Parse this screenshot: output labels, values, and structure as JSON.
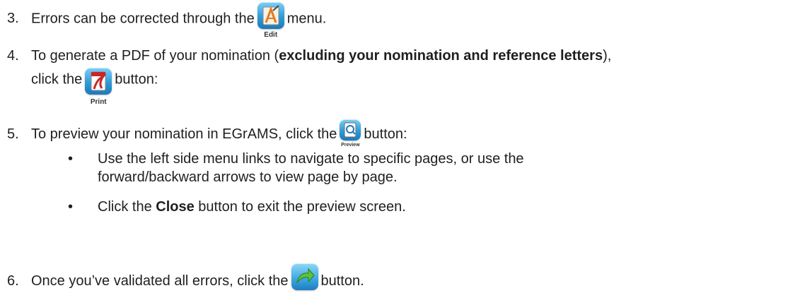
{
  "steps": [
    {
      "number": "3.",
      "before": "Errors can be corrected through the",
      "after": "menu.",
      "icon": {
        "name": "edit-icon",
        "caption": "Edit"
      }
    },
    {
      "number": "4.",
      "line1_before": "To generate a PDF of your nomination (",
      "line1_bold": "excluding your nomination and reference letters",
      "line1_after": "),",
      "line2_before": "click the",
      "line2_after": "button:",
      "icon": {
        "name": "print-icon",
        "caption": "Print"
      }
    },
    {
      "number": "5.",
      "before": "To preview your nomination in EGrAMS, click the",
      "after": "button:",
      "icon": {
        "name": "preview-icon",
        "caption": "Preview"
      },
      "bullets": [
        {
          "line1": "Use the left side menu links to navigate to specific pages, or use the",
          "line2": "forward/backward arrows to view page by page."
        },
        {
          "before": "Click the",
          "bold": "Close",
          "after": "button to exit the preview screen."
        }
      ]
    },
    {
      "number": "6.",
      "before": "Once you’ve validated all errors, click the",
      "after": "button.",
      "icon": {
        "name": "submit-arrow-icon",
        "caption": ""
      }
    }
  ],
  "bullet_glyph": "•",
  "colors": {
    "icon_top": "#7fd0f6",
    "icon_bottom": "#1c78b8",
    "text": "#1f1f1f"
  }
}
